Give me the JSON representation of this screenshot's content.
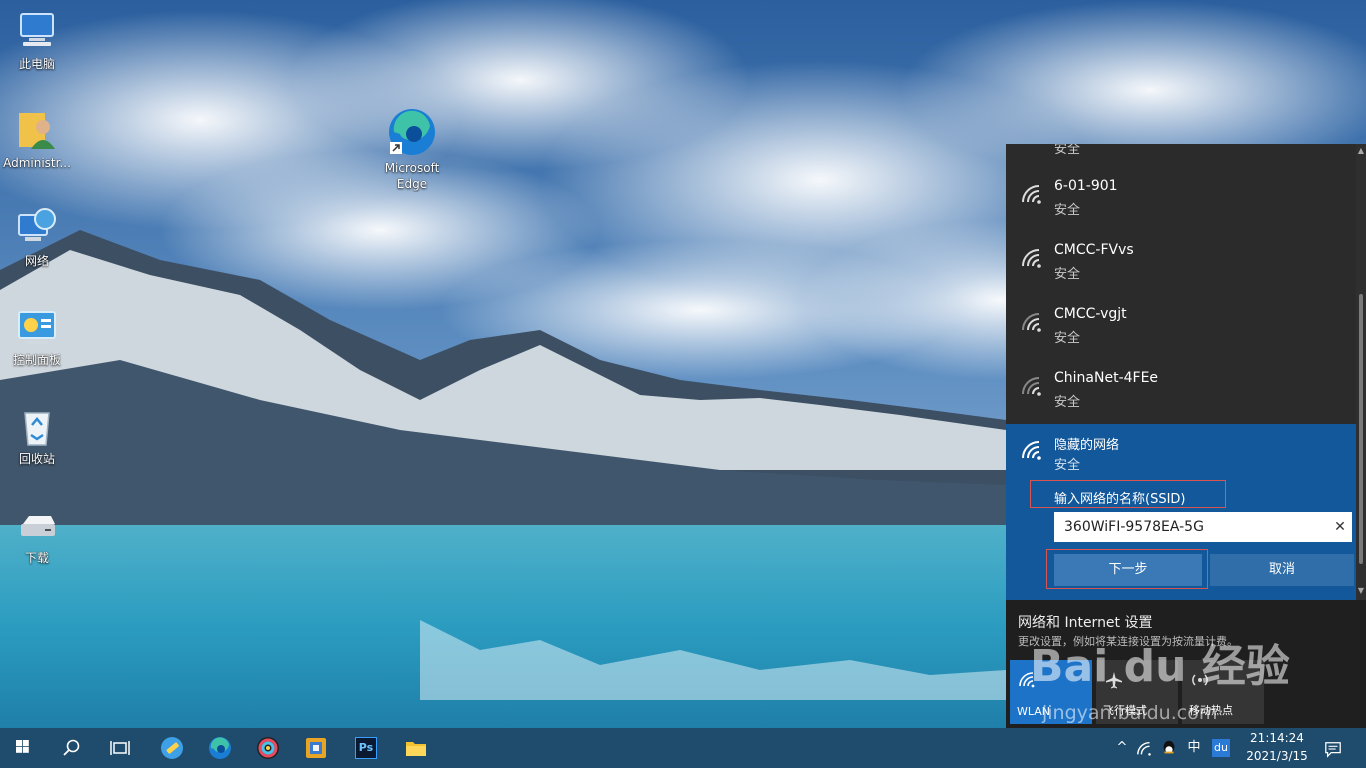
{
  "desktop": {
    "icons": [
      {
        "label": "此电脑",
        "icon": "computer-icon"
      },
      {
        "label": "Administr...",
        "icon": "user-folder-icon"
      },
      {
        "label": "网络",
        "icon": "network-icon"
      },
      {
        "label": "控制面板",
        "icon": "control-panel-icon"
      },
      {
        "label": "回收站",
        "icon": "recycle-bin-icon"
      },
      {
        "label": "下载",
        "icon": "drive-icon"
      },
      {
        "label": "Microsoft Edge",
        "icon": "edge-icon"
      }
    ]
  },
  "flyout": {
    "top_partial_sec": "安全",
    "networks": [
      {
        "ssid": "6-01-901",
        "security": "安全"
      },
      {
        "ssid": "CMCC-FVvs",
        "security": "安全"
      },
      {
        "ssid": "CMCC-vgjt",
        "security": "安全"
      },
      {
        "ssid": "ChinaNet-4FEe",
        "security": "安全"
      }
    ],
    "hidden": {
      "ssid": "隐藏的网络",
      "security": "安全",
      "input_label": "输入网络的名称(SSID)",
      "input_value": "360WiFI-9578EA-5G",
      "clear_glyph": "✕",
      "next_label": "下一步",
      "cancel_label": "取消"
    },
    "settings": {
      "link": "网络和 Internet 设置",
      "desc": "更改设置，例如将某连接设置为按流量计费。"
    },
    "quick_actions": [
      {
        "label": "WLAN",
        "active": true
      },
      {
        "label": "飞行模式",
        "active": false
      },
      {
        "label": "移动热点",
        "active": false
      }
    ]
  },
  "taskbar": {
    "apps": [
      "start-icon",
      "search-icon",
      "task-view-icon",
      "pen-app-icon",
      "edge-icon",
      "color-app-icon",
      "files-app-icon",
      "photoshop-icon",
      "file-explorer-icon"
    ],
    "photoshop_text": "Ps",
    "tray": {
      "chevron": "^",
      "ime": "中",
      "du": "du",
      "time": "21:14:24",
      "date": "2021/3/15"
    }
  },
  "watermark": {
    "brand": "Bai du 经验",
    "url": "jingyan.baidu.com"
  },
  "colors": {
    "accent": "#1d73c8",
    "highlight_border": "#d9534f",
    "flyout_bg": "#2b2b2b",
    "hidden_panel": "#13589a"
  }
}
